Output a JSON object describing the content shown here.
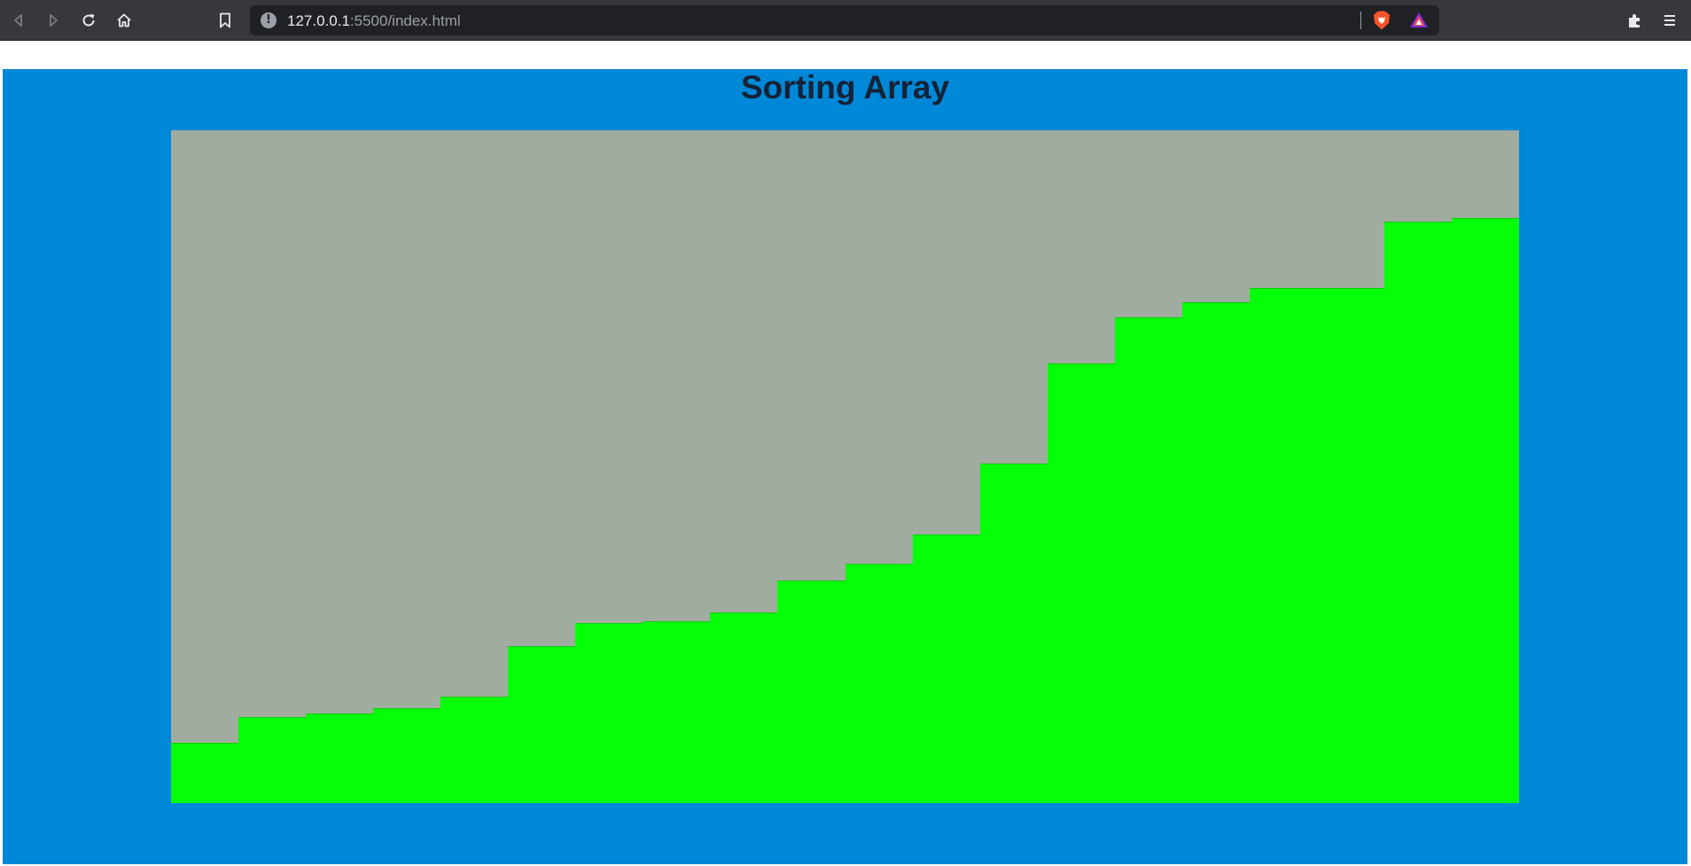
{
  "browser": {
    "url_host": "127.0.0.1",
    "url_rest": ":5500/index.html",
    "back_icon": "back-arrow-icon",
    "forward_icon": "forward-arrow-icon",
    "reload_icon": "reload-icon",
    "home_icon": "home-icon",
    "bookmark_icon": "bookmark-icon",
    "info_icon": "info-icon",
    "extensions_icon": "puzzle-icon",
    "menu_icon": "hamburger-menu-icon"
  },
  "page": {
    "title": "Sorting Array",
    "background_color": "#0088d8",
    "panel_color": "#a1aca0",
    "bar_color": "#04ff08"
  },
  "array": {
    "values": [
      89,
      128,
      133,
      141,
      158,
      233,
      267,
      270,
      283,
      331,
      356,
      399,
      505,
      654,
      722,
      744,
      766,
      766,
      864,
      869
    ],
    "max_value": 1000,
    "sorted_ascending": true
  }
}
